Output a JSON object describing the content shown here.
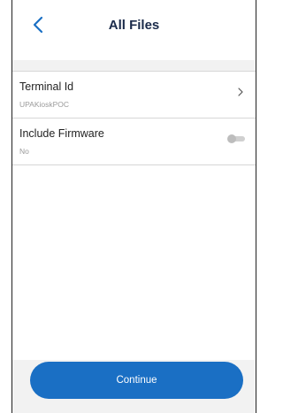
{
  "header": {
    "title": "All Files",
    "back_icon": "chevron-left-icon"
  },
  "rows": [
    {
      "label": "Terminal Id",
      "value": "UPAKioskPOC",
      "accessory": "chevron-right-icon"
    },
    {
      "label": "Include Firmware",
      "value": "No",
      "accessory": "toggle",
      "toggle_on": false
    }
  ],
  "footer": {
    "continue_label": "Continue"
  },
  "colors": {
    "accent": "#1a6fc4",
    "title": "#1a2a4a",
    "background_band": "#f2f2f2"
  }
}
